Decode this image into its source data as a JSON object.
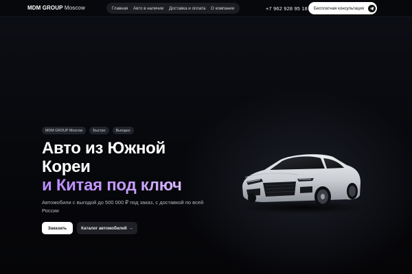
{
  "header": {
    "brand_strong": "MDM GROUP",
    "brand_city": "Moscow",
    "nav": [
      "Главная",
      "Авто в наличии",
      "Доставка и оплата",
      "О компании"
    ],
    "phone": "+7 962 928 95 18",
    "consult_label": "Бесплатная консультация"
  },
  "hero": {
    "tags": [
      "MDM GROUP Moscow",
      "Быстро",
      "Выгодно"
    ],
    "title_line1": "Авто из Южной",
    "title_line2": "Кореи",
    "title_line3": "и Китая под ключ",
    "subtitle": "Автомобили с выгодой до 500 000 ₽ под заказ, с доставкой по всей России",
    "order_button": "Заказать",
    "catalog_button": "Каталог автомобилей",
    "catalog_arrow": "→"
  },
  "colors": {
    "accent_gradient_start": "#b98cff",
    "accent_gradient_end": "#d7b8ff",
    "background": "#05060a",
    "primary_button": "#ffffff",
    "secondary_button": "#1e2026"
  },
  "icons": {
    "consult_icon": "telegram-icon",
    "hero_image": "white-sedan-car"
  }
}
